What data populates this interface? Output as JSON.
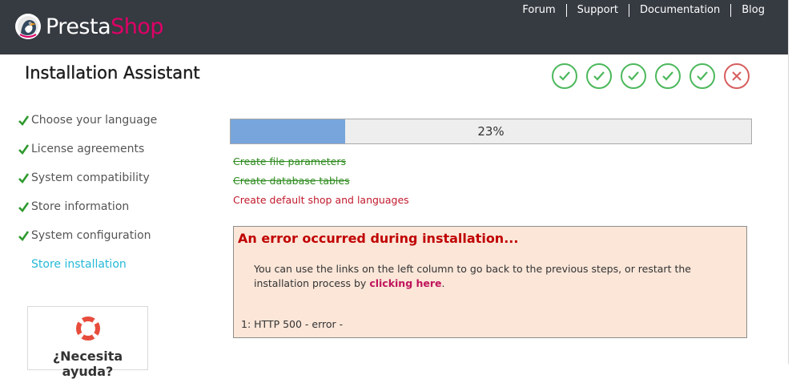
{
  "header": {
    "brand_presta": "Presta",
    "brand_shop": "Shop",
    "nav": [
      "Forum",
      "Support",
      "Documentation",
      "Blog"
    ],
    "colors": {
      "background": "#363a41",
      "brand_pink": "#df0067"
    }
  },
  "title": "Installation Assistant",
  "steps_status": [
    {
      "icon": "check-icon",
      "state": "done"
    },
    {
      "icon": "check-icon",
      "state": "done"
    },
    {
      "icon": "check-icon",
      "state": "done"
    },
    {
      "icon": "check-icon",
      "state": "done"
    },
    {
      "icon": "check-icon",
      "state": "done"
    },
    {
      "icon": "x-icon",
      "state": "error"
    }
  ],
  "sidebar": {
    "items": [
      {
        "label": "Choose your language",
        "done": true
      },
      {
        "label": "License agreements",
        "done": true
      },
      {
        "label": "System compatibility",
        "done": true
      },
      {
        "label": "Store information",
        "done": true
      },
      {
        "label": "System configuration",
        "done": true
      },
      {
        "label": "Store installation",
        "done": false
      }
    ],
    "help_label": "¿Necesita ayuda?"
  },
  "progress": {
    "value": 0.22,
    "label": "23%"
  },
  "tasks": [
    {
      "label": "Create file parameters",
      "state": "done"
    },
    {
      "label": "Create database tables",
      "state": "done"
    },
    {
      "label": "Create default shop and languages",
      "state": "failed"
    }
  ],
  "error": {
    "title": "An error occurred during installation...",
    "message_before": "You can use the links on the left column to go back to the previous steps, or restart the installation process by ",
    "link": "clicking here",
    "message_after": ".",
    "detail": "1: HTTP 500 - error -"
  }
}
